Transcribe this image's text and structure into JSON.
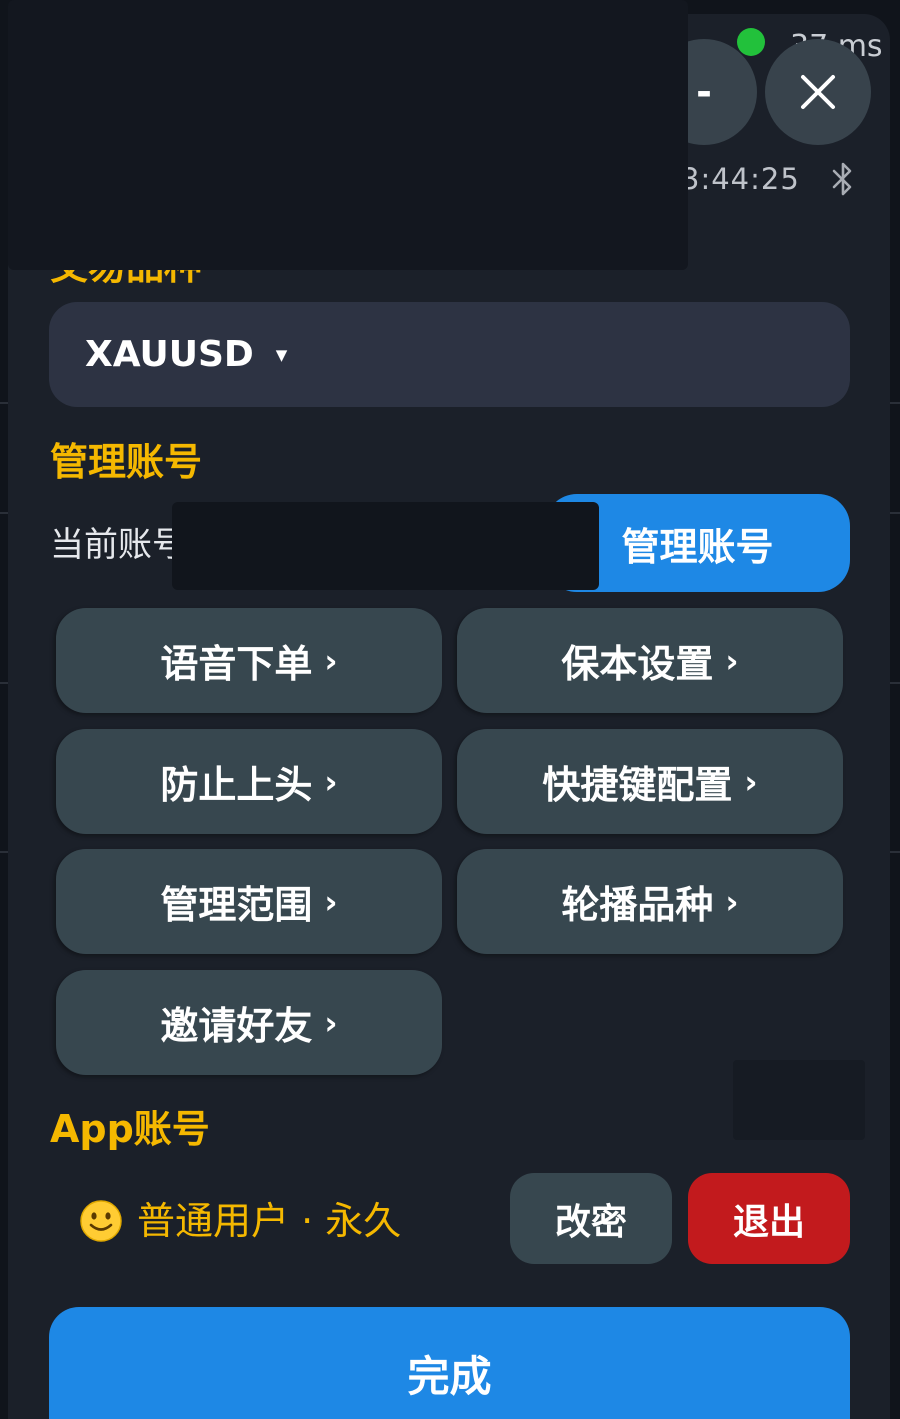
{
  "status": {
    "latency": "37 ms",
    "connection_color": "#22c13b",
    "minimize_label": "-",
    "close_icon": "close-icon",
    "time": "3:44:25",
    "bluetooth_icon": "bluetooth-icon"
  },
  "symbol_section": {
    "title": "交易品种",
    "selected_symbol": "XAUUSD",
    "caret": "▼"
  },
  "account_section": {
    "title": "管理账号",
    "current_account_label": "当前账号",
    "manage_button": "管理账号"
  },
  "menu": {
    "chevron": "›",
    "items": [
      {
        "label": "语音下单"
      },
      {
        "label": "保本设置"
      },
      {
        "label": "防止上头"
      },
      {
        "label": "快捷键配置"
      },
      {
        "label": "管理范围"
      },
      {
        "label": "轮播品种"
      },
      {
        "label": "邀请好友"
      }
    ]
  },
  "app_account": {
    "title": "App账号",
    "user_icon": "slightly-smiling-face-icon",
    "user_status": "普通用户 · 永久",
    "change_password_button": "改密",
    "logout_button": "退出"
  },
  "done_button": "完成",
  "colors": {
    "accent_yellow": "#f5b800",
    "primary_blue": "#1e88e5",
    "danger_red": "#c21a1d",
    "button_gray": "#37474f",
    "panel_bg": "#1b2029"
  }
}
